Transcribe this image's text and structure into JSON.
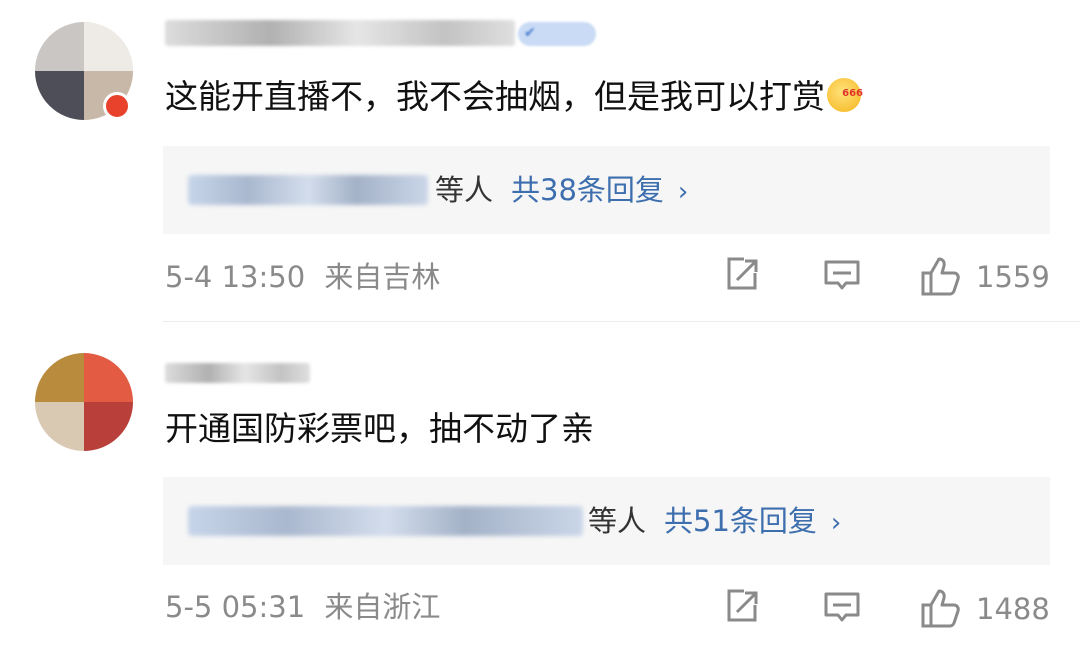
{
  "comments": [
    {
      "text": "这能开直播不，我不会抽烟，但是我可以打赏",
      "emoji": "grin-666-emoji",
      "reply_suffix": "等人",
      "reply_count_label": "共38条回复",
      "time": "5-4 13:50",
      "location": "来自吉林",
      "likes": "1559"
    },
    {
      "text": "开通国防彩票吧，抽不动了亲",
      "reply_suffix": "等人",
      "reply_count_label": "共51条回复",
      "time": "5-5 05:31",
      "location": "来自浙江",
      "likes": "1488"
    }
  ],
  "colors": {
    "link": "#3d6eae",
    "meta": "#8a8a8a",
    "reply_bg": "#f6f6f6",
    "badge": "#e8412c"
  },
  "icons": [
    "share-icon",
    "comment-icon",
    "like-icon",
    "chevron-right-icon"
  ]
}
